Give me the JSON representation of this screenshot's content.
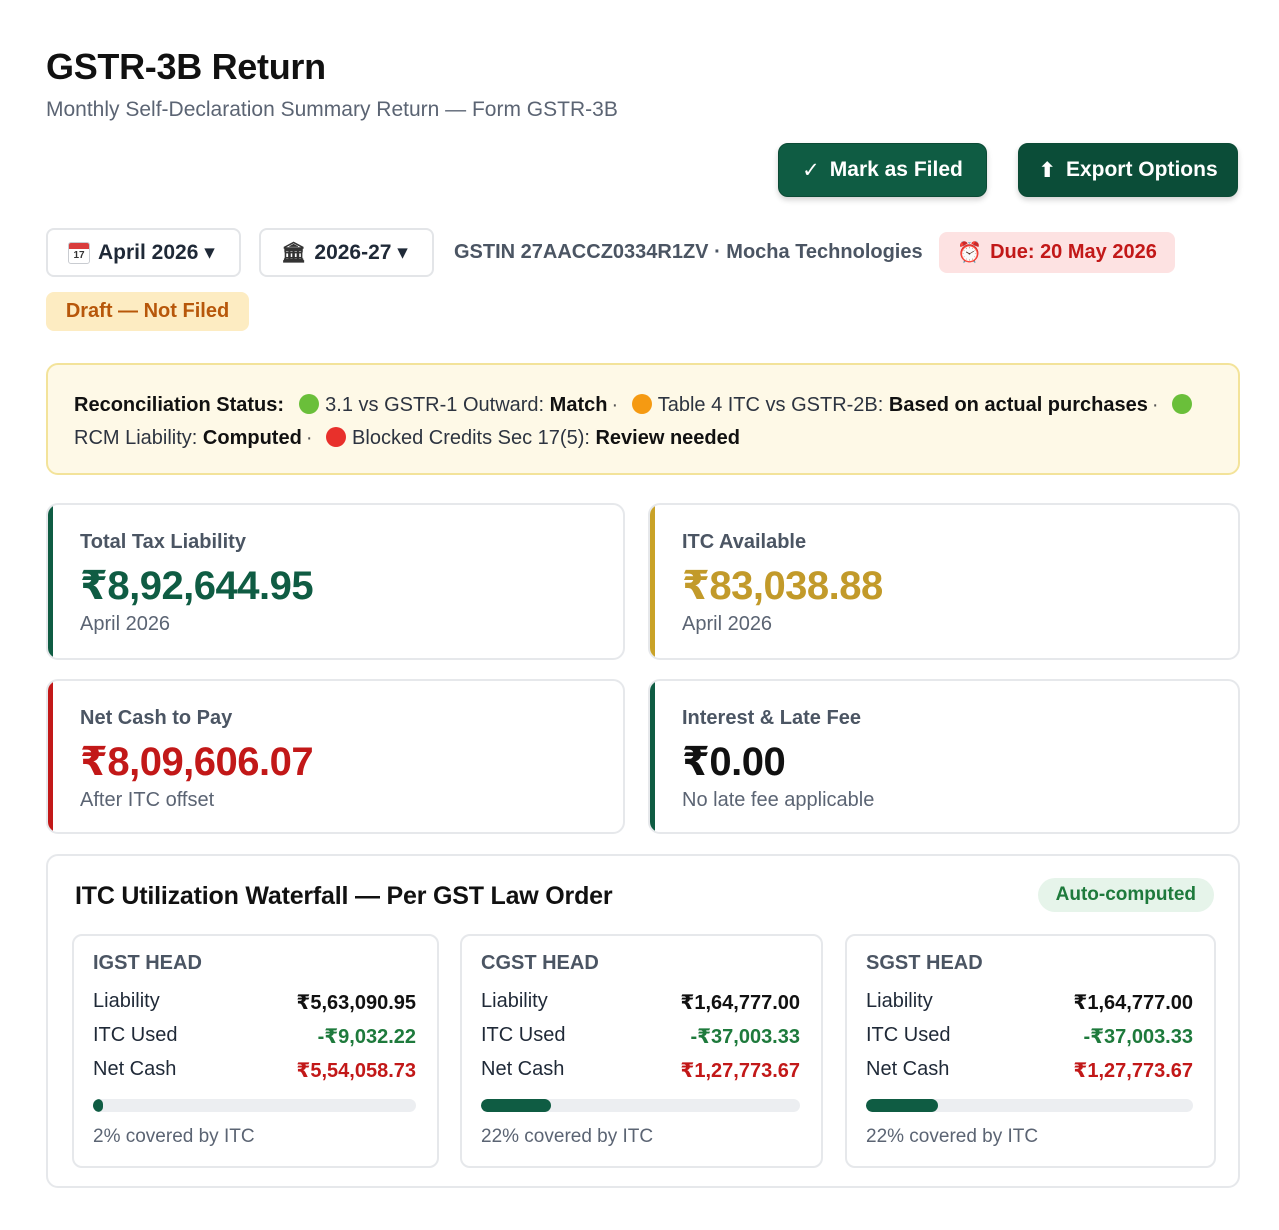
{
  "header": {
    "title": "GSTR-3B Return",
    "subtitle": "Monthly Self-Declaration Summary Return — Form GSTR-3B"
  },
  "actions": {
    "mark_filed_icon": "✓",
    "mark_filed_label": "Mark as Filed",
    "export_icon": "⬆",
    "export_label": "Export Options"
  },
  "filters": {
    "month_label": "April 2026 ▾",
    "calendar_day": "17",
    "year_label": "2026-27 ▾",
    "bank_icon": "🏛"
  },
  "meta": {
    "gstin_text": "GSTIN 27AACCZ0334R1ZV · Mocha Technologies",
    "due_icon": "⏰",
    "due_label": "Due: 20 May 2026",
    "status_label": "Draft — Not Filed"
  },
  "reconciliation": {
    "label": "Reconciliation Status:",
    "items": [
      {
        "status": "green",
        "text": "3.1 vs GSTR-1 Outward: ",
        "result": "Match"
      },
      {
        "status": "orange",
        "text": "Table 4 ITC vs GSTR-2B: ",
        "result": "Based on actual purchases"
      },
      {
        "status": "green",
        "text": "RCM Liability: ",
        "result": "Computed"
      },
      {
        "status": "red",
        "text": "Blocked Credits Sec 17(5): ",
        "result": "Review needed"
      }
    ],
    "separator": "·"
  },
  "summary_cards": [
    {
      "label": "Total Tax Liability",
      "value": "₹8,92,644.95",
      "note": "April 2026",
      "accent": "#0f5c43"
    },
    {
      "label": "ITC Available",
      "value": "₹83,038.88",
      "note": "April 2026",
      "accent": "#c9a227"
    },
    {
      "label": "Net Cash to Pay",
      "value": "₹8,09,606.07",
      "note": "After ITC offset",
      "accent": "#c21818"
    },
    {
      "label": "Interest & Late Fee",
      "value": "₹0.00",
      "note": "No late fee applicable",
      "accent": "#0f5c43"
    }
  ],
  "waterfall": {
    "title": "ITC Utilization Waterfall — Per GST Law Order",
    "badge": "Auto-computed",
    "row_labels": {
      "liability": "Liability",
      "itc_used": "ITC Used",
      "net_cash": "Net Cash"
    },
    "heads": [
      {
        "name": "IGST HEAD",
        "liability": "₹5,63,090.95",
        "itc_used": "-₹9,032.22",
        "net_cash": "₹5,54,058.73",
        "coverage_pct": 2,
        "coverage_text": "2% covered by ITC"
      },
      {
        "name": "CGST HEAD",
        "liability": "₹1,64,777.00",
        "itc_used": "-₹37,003.33",
        "net_cash": "₹1,27,773.67",
        "coverage_pct": 22,
        "coverage_text": "22% covered by ITC"
      },
      {
        "name": "SGST HEAD",
        "liability": "₹1,64,777.00",
        "itc_used": "-₹37,003.33",
        "net_cash": "₹1,27,773.67",
        "coverage_pct": 22,
        "coverage_text": "22% covered by ITC"
      }
    ]
  }
}
